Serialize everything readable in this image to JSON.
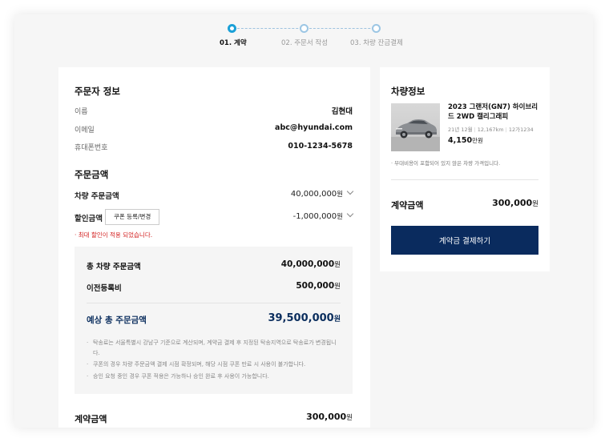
{
  "stepper": {
    "steps": [
      {
        "label": "01. 계약",
        "active": true
      },
      {
        "label": "02. 주문서 작성",
        "active": false
      },
      {
        "label": "03. 차량 잔금결제",
        "active": false
      }
    ]
  },
  "orderer": {
    "title": "주문자 정보",
    "name_label": "이름",
    "name_value": "김현대",
    "email_label": "이메일",
    "email_value": "abc@hyundai.com",
    "phone_label": "휴대폰번호",
    "phone_value": "010-1234-5678"
  },
  "order_amount": {
    "title": "주문금액",
    "vehicle_label": "차량 주문금액",
    "vehicle_value": "40,000,000",
    "discount_label": "할인금액",
    "coupon_button": "쿠폰 등록/변경",
    "discount_value": "-1,000,000",
    "discount_note": "· 최대 할인이 적용 되었습니다.",
    "won": "원"
  },
  "summary": {
    "total_vehicle_label": "총 차량 주문금액",
    "total_vehicle_value": "40,000,000",
    "transfer_label": "이전등록비",
    "transfer_value": "500,000",
    "expected_label": "예상 총 주문금액",
    "expected_value": "39,500,000",
    "notes": [
      "탁송료는 서울특별시 강남구 기준으로 계산되며, 계약금 결제 후 지정된 탁송지역으로 탁송료가 변경됩니다.",
      "쿠폰의 경우 차량 주문금액 결제 시점 확정되며, 해당 시점 쿠폰 만료 시 사용이 불가합니다.",
      "승인 요청 중인 경우 쿠폰 적용은 가능하나 승인 완료 후 사용이 가능합니다."
    ]
  },
  "contract": {
    "label": "계약금액",
    "value": "300,000"
  },
  "vehicle": {
    "title": "차량정보",
    "name": "2023 그랜저(GN7) 하이브리드 2WD 캘리그래피",
    "spec_date": "21년 12월",
    "spec_km": "12,167km",
    "spec_no": "12가1234",
    "price": "4,150",
    "price_unit": "만원",
    "note": "· 부대비용이 포함되어 있지 않은 차량 가격입니다.",
    "contract_label": "계약금액",
    "contract_value": "300,000",
    "pay_button": "계약금 결제하기"
  },
  "colors": {
    "accent_navy": "#0a2b5e",
    "stepper_active": "#1aa0d7",
    "warning_red": "#d32020"
  }
}
